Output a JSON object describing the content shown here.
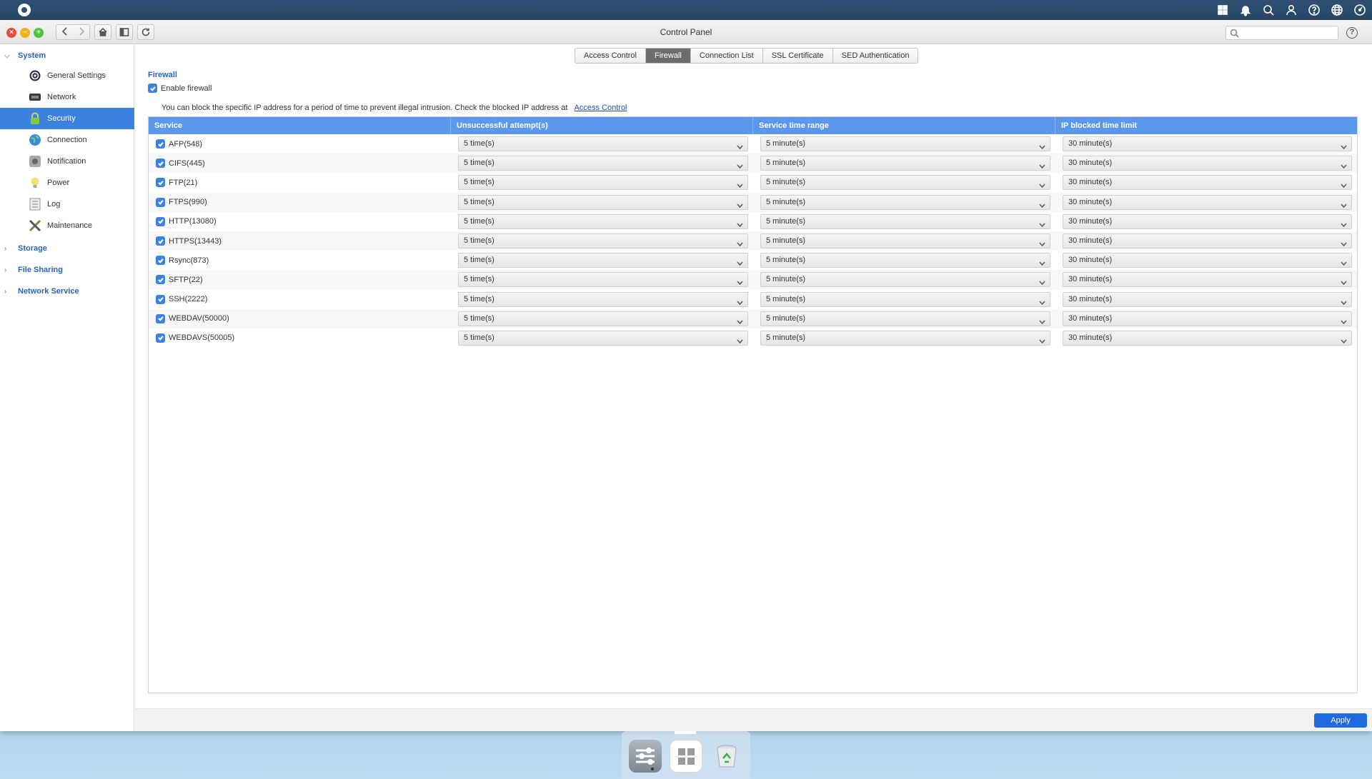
{
  "window": {
    "title": "Control Panel"
  },
  "tabs": [
    "Access Control",
    "Firewall",
    "Connection List",
    "SSL Certificate",
    "SED Authentication"
  ],
  "active_tab": "Firewall",
  "sidebar": {
    "system_label": "System",
    "items": [
      {
        "label": "General Settings",
        "icon": "gear-icon",
        "active": false
      },
      {
        "label": "Network",
        "icon": "network-icon",
        "active": false
      },
      {
        "label": "Security",
        "icon": "lock-icon",
        "active": true
      },
      {
        "label": "Connection",
        "icon": "globe-icon",
        "active": false
      },
      {
        "label": "Notification",
        "icon": "notification-icon",
        "active": false
      },
      {
        "label": "Power",
        "icon": "bulb-icon",
        "active": false
      },
      {
        "label": "Log",
        "icon": "log-icon",
        "active": false
      },
      {
        "label": "Maintenance",
        "icon": "tools-icon",
        "active": false
      }
    ],
    "sections": [
      "Storage",
      "File Sharing",
      "Network Service"
    ]
  },
  "firewall": {
    "title": "Firewall",
    "enable_label": "Enable firewall",
    "info_text": "You can block the specific IP address for a period of time to prevent illegal intrusion. Check the blocked IP address at",
    "info_link": "Access Control"
  },
  "table": {
    "headers": [
      "Service",
      "Unsuccessful attempt(s)",
      "Service time range",
      "IP blocked time limit"
    ],
    "rows": [
      {
        "service": "AFP(548)",
        "attempts": "5 time(s)",
        "range": "5 minute(s)",
        "limit": "30 minute(s)"
      },
      {
        "service": "CIFS(445)",
        "attempts": "5 time(s)",
        "range": "5 minute(s)",
        "limit": "30 minute(s)"
      },
      {
        "service": "FTP(21)",
        "attempts": "5 time(s)",
        "range": "5 minute(s)",
        "limit": "30 minute(s)"
      },
      {
        "service": "FTPS(990)",
        "attempts": "5 time(s)",
        "range": "5 minute(s)",
        "limit": "30 minute(s)"
      },
      {
        "service": "HTTP(13080)",
        "attempts": "5 time(s)",
        "range": "5 minute(s)",
        "limit": "30 minute(s)"
      },
      {
        "service": "HTTPS(13443)",
        "attempts": "5 time(s)",
        "range": "5 minute(s)",
        "limit": "30 minute(s)"
      },
      {
        "service": "Rsync(873)",
        "attempts": "5 time(s)",
        "range": "5 minute(s)",
        "limit": "30 minute(s)"
      },
      {
        "service": "SFTP(22)",
        "attempts": "5 time(s)",
        "range": "5 minute(s)",
        "limit": "30 minute(s)"
      },
      {
        "service": "SSH(2222)",
        "attempts": "5 time(s)",
        "range": "5 minute(s)",
        "limit": "30 minute(s)"
      },
      {
        "service": "WEBDAV(50000)",
        "attempts": "5 time(s)",
        "range": "5 minute(s)",
        "limit": "30 minute(s)"
      },
      {
        "service": "WEBDAVS(50005)",
        "attempts": "5 time(s)",
        "range": "5 minute(s)",
        "limit": "30 minute(s)"
      }
    ]
  },
  "footer": {
    "apply_label": "Apply"
  },
  "colors": {
    "accent": "#3b82e0",
    "header": "#5b97ec",
    "link": "#2a63b8",
    "apply": "#1f6ae0"
  }
}
